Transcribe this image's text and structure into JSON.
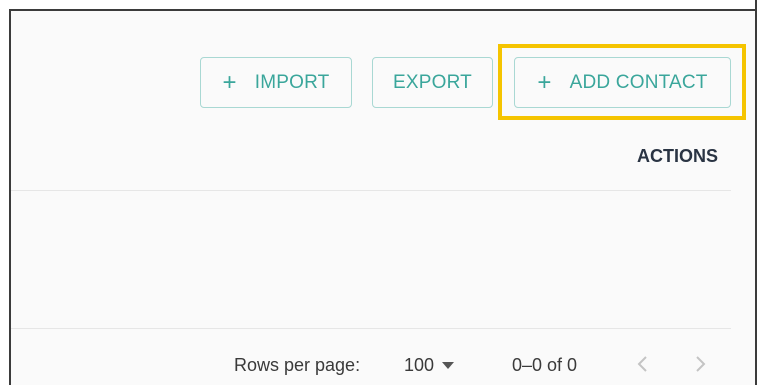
{
  "toolbar": {
    "import_label": "IMPORT",
    "export_label": "EXPORT",
    "add_contact_label": "ADD CONTACT",
    "plus_icon": "+"
  },
  "table": {
    "actions_header": "ACTIONS"
  },
  "pagination": {
    "rows_per_page_label": "Rows per page:",
    "rows_per_page_value": "100",
    "range_text": "0–0 of 0"
  },
  "colors": {
    "accent": "#3aa69b",
    "highlight": "#f5c400"
  }
}
